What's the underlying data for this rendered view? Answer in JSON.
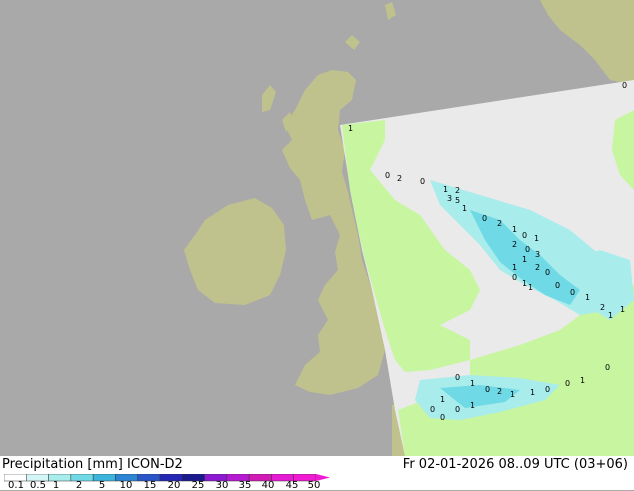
{
  "map": {
    "ocean_color": "#a9a9a9",
    "land_color": "#c0c28e",
    "model_domain_color": "#eaeaea",
    "model_land_color": "#c8f5a0",
    "precip_labels": [
      "1",
      "0",
      "2",
      "0",
      "1",
      "2",
      "3",
      "5",
      "1",
      "0",
      "2",
      "1",
      "0",
      "1",
      "2",
      "0",
      "3",
      "1",
      "1",
      "2",
      "0",
      "1",
      "0",
      "1",
      "0",
      "0",
      "1",
      "2",
      "1",
      "1",
      "0",
      "1",
      "0",
      "2",
      "1",
      "1",
      "0",
      "0",
      "1",
      "1",
      "0",
      "0",
      "1",
      "0",
      "0",
      "0"
    ]
  },
  "footer": {
    "title": "Precipitation [mm]  ICON-D2",
    "valid_time": "Fr 02-01-2026 08..09 UTC (03+06)",
    "colorbar": {
      "ticks": [
        "0.1",
        "0.5",
        "1",
        "2",
        "5",
        "10",
        "15",
        "20",
        "25",
        "30",
        "35",
        "40",
        "45",
        "50"
      ],
      "colors": [
        "#ffffff",
        "#d4f5f5",
        "#a8ecec",
        "#6fd9e6",
        "#3cb4dc",
        "#2b85d2",
        "#2a55c8",
        "#2626b4",
        "#1a1a8c",
        "#8c1ad2",
        "#b41ad2",
        "#d21ab4",
        "#e61ad2",
        "#f01ad2"
      ]
    }
  }
}
